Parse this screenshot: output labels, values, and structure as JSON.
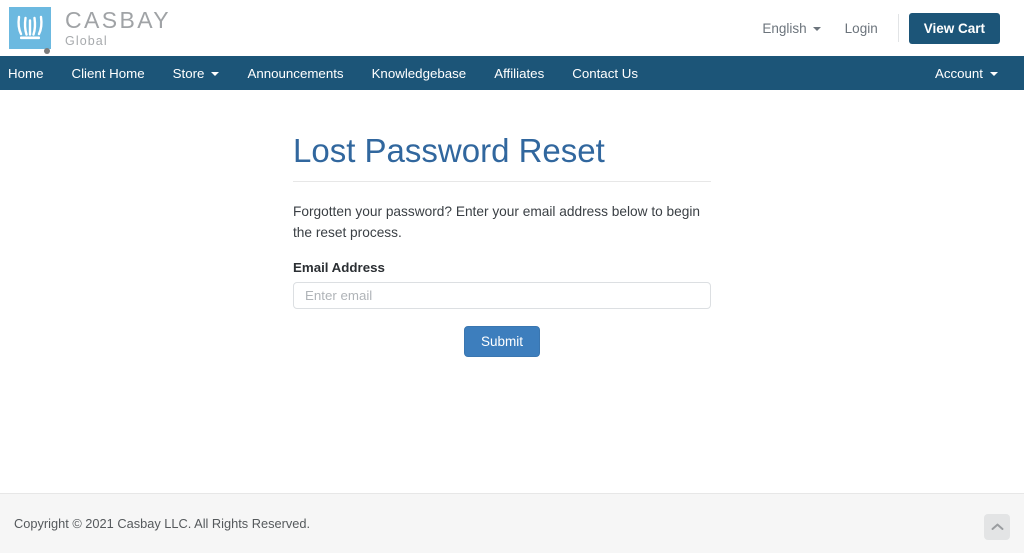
{
  "header": {
    "logo": {
      "icon": "casbay-crown-logo-icon",
      "title": "CASBAY",
      "subtitle": "Global",
      "mark_color": "#6cb9e0"
    },
    "language": {
      "label": "English",
      "icon": "chevron-down-icon"
    },
    "login_label": "Login",
    "cart_label": "View Cart",
    "cart_color": "#1c5578"
  },
  "navbar": {
    "background": "#1c5578",
    "left_items": [
      {
        "label": "Home",
        "has_caret": false
      },
      {
        "label": "Client Home",
        "has_caret": false
      },
      {
        "label": "Store",
        "has_caret": true
      },
      {
        "label": "Announcements",
        "has_caret": false
      },
      {
        "label": "Knowledgebase",
        "has_caret": false
      },
      {
        "label": "Affiliates",
        "has_caret": false
      },
      {
        "label": "Contact Us",
        "has_caret": false
      }
    ],
    "right_items": [
      {
        "label": "Account",
        "has_caret": true
      }
    ]
  },
  "main": {
    "title": "Lost Password Reset",
    "title_color": "#31679e",
    "lead": "Forgotten your password? Enter your email address below to begin the reset process.",
    "form": {
      "email_label": "Email Address",
      "email_value": "",
      "email_placeholder": "Enter email",
      "submit_label": "Submit",
      "submit_color": "#3d7ebd"
    }
  },
  "footer": {
    "copyright": "Copyright © 2021 Casbay LLC. All Rights Reserved.",
    "to_top_icon": "chevron-up-icon"
  }
}
